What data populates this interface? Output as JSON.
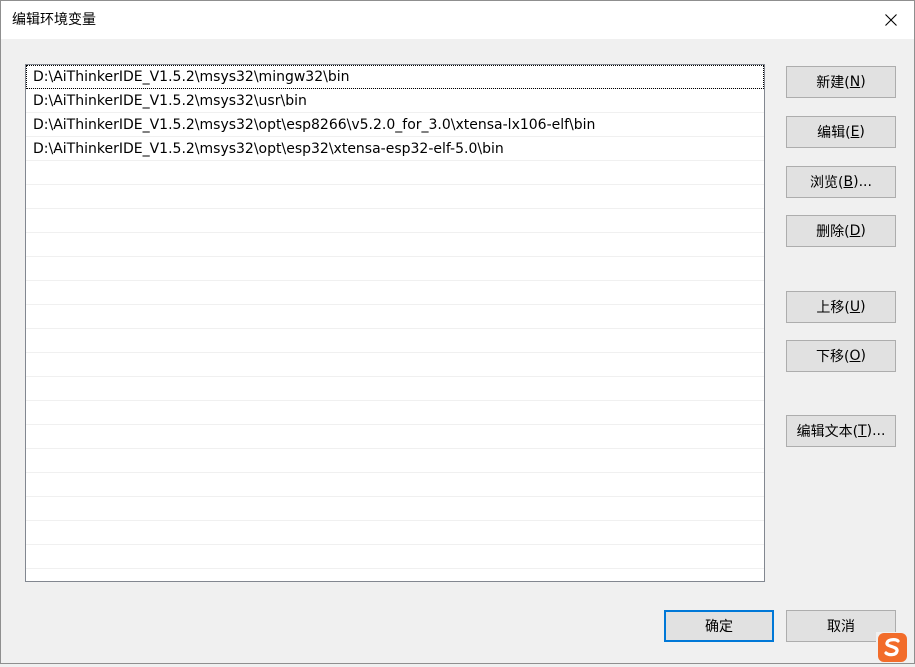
{
  "window": {
    "title": "编辑环境变量"
  },
  "paths": [
    "D:\\AiThinkerIDE_V1.5.2\\msys32\\mingw32\\bin",
    "D:\\AiThinkerIDE_V1.5.2\\msys32\\usr\\bin",
    "D:\\AiThinkerIDE_V1.5.2\\msys32\\opt\\esp8266\\v5.2.0_for_3.0\\xtensa-lx106-elf\\bin",
    "D:\\AiThinkerIDE_V1.5.2\\msys32\\opt\\esp32\\xtensa-esp32-elf-5.0\\bin"
  ],
  "buttons": {
    "new": {
      "label": "新建(",
      "key": "N",
      "suffix": ")"
    },
    "edit": {
      "label": "编辑(",
      "key": "E",
      "suffix": ")"
    },
    "browse": {
      "label": "浏览(",
      "key": "B",
      "suffix": ")..."
    },
    "delete": {
      "label": "删除(",
      "key": "D",
      "suffix": ")"
    },
    "move_up": {
      "label": "上移(",
      "key": "U",
      "suffix": ")"
    },
    "move_down": {
      "label": "下移(",
      "key": "O",
      "suffix": ")"
    },
    "edit_text": {
      "label": "编辑文本(",
      "key": "T",
      "suffix": ")..."
    },
    "ok": "确定",
    "cancel": "取消"
  },
  "icons": {
    "close": "close-icon",
    "tray": "sogou-input-icon"
  },
  "colors": {
    "focus_border": "#0078d7",
    "sogou_orange": "#f26c2a"
  }
}
